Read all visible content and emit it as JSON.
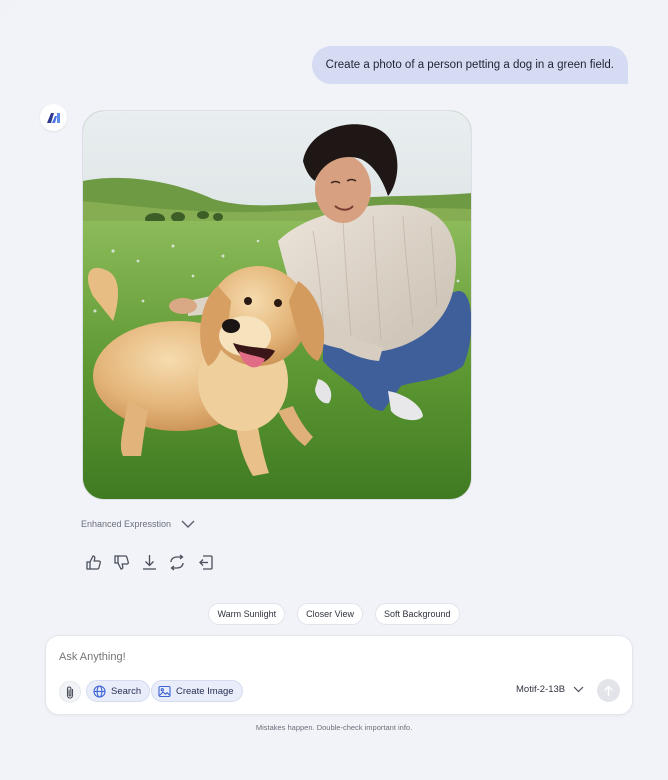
{
  "conversation": {
    "user_message": "Create a photo of a person petting a dog in a green field.",
    "assistant": {
      "avatar_icon": "motif-logo-icon",
      "image_icon": "generated-image",
      "enhanced_label": "Enhanced Expresstion",
      "actions": [
        "thumbs-up-icon",
        "thumbs-down-icon",
        "download-icon",
        "regenerate-icon",
        "export-icon"
      ]
    }
  },
  "suggestions": [
    "Warm Sunlight",
    "Closer View",
    "Soft Background"
  ],
  "composer": {
    "placeholder": "Ask Anything!",
    "search_label": "Search",
    "create_image_label": "Create Image",
    "model": "Motif-2-13B"
  },
  "disclaimer": "Mistakes happen. Double-check important info.",
  "colors": {
    "accent": "#3d63d6",
    "user_bubble": "#d5dbf3",
    "background": "#f1f3f8"
  }
}
